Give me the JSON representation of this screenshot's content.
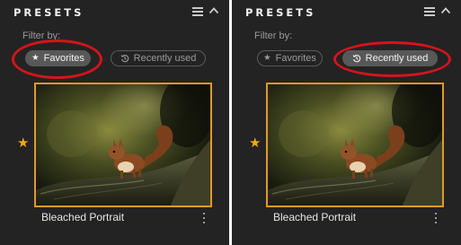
{
  "panels": [
    {
      "id": "left",
      "title": "PRESETS",
      "filter_label": "Filter by:",
      "filters": [
        {
          "label": "Favorites",
          "icon": "star-icon",
          "active": true
        },
        {
          "label": "Recently used",
          "icon": "history-icon",
          "active": false
        }
      ],
      "highlighted_filter": "Favorites",
      "preset": {
        "name": "Bleached Portrait",
        "favorite": true,
        "selected": true
      }
    },
    {
      "id": "right",
      "title": "PRESETS",
      "filter_label": "Filter by:",
      "filters": [
        {
          "label": "Favorites",
          "icon": "star-icon",
          "active": false
        },
        {
          "label": "Recently used",
          "icon": "history-icon",
          "active": true
        }
      ],
      "highlighted_filter": "Recently used",
      "preset": {
        "name": "Bleached Portrait",
        "favorite": true,
        "selected": true
      }
    }
  ],
  "colors": {
    "panel_bg": "#232323",
    "accent_selection": "#e09a2a",
    "favorite_star": "#f2a51f",
    "highlight_annotation": "#d4141c",
    "chip_active_bg": "#585858"
  }
}
